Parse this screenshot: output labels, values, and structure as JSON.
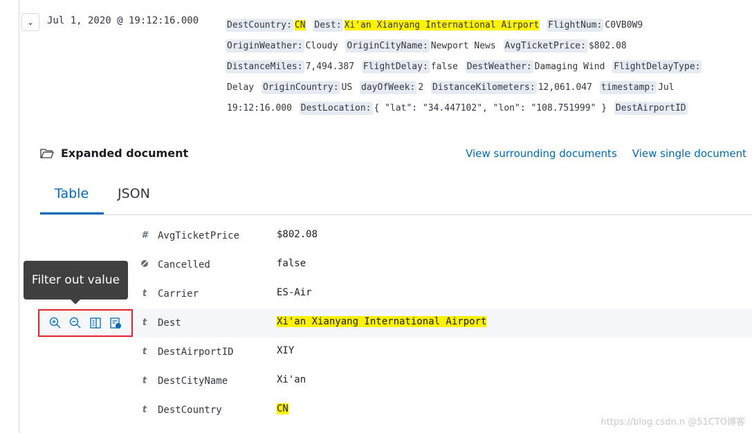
{
  "doc": {
    "timestamp": "Jul 1, 2020 @ 19:12:16.000",
    "summary_lines": [
      [
        {
          "k": "DestCountry:",
          "v": "CN",
          "hl": true
        },
        {
          "k": "Dest:",
          "v": "Xi'an Xianyang International Airport",
          "hl": true
        },
        {
          "k": "FlightNum:",
          "v": "C0VB0W9"
        }
      ],
      [
        {
          "k": "OriginWeather:",
          "v": "Cloudy"
        },
        {
          "k": "OriginCityName:",
          "v": "Newport News"
        },
        {
          "k": "AvgTicketPrice:",
          "v": "$802.08"
        }
      ],
      [
        {
          "k": "DistanceMiles:",
          "v": "7,494.387"
        },
        {
          "k": "FlightDelay:",
          "v": "false"
        },
        {
          "k": "DestWeather:",
          "v": "Damaging Wind"
        },
        {
          "k": "FlightDelayType:",
          "v": ""
        }
      ],
      [
        {
          "k": "",
          "v": "Delay"
        },
        {
          "k": "OriginCountry:",
          "v": "US"
        },
        {
          "k": "dayOfWeek:",
          "v": "2"
        },
        {
          "k": "DistanceKilometers:",
          "v": "12,061.047"
        },
        {
          "k": "timestamp:",
          "v": "Jul"
        }
      ],
      [
        {
          "k": "",
          "v": "19:12:16.000"
        },
        {
          "k": "DestLocation:",
          "v": "{ \"lat\": \"34.447102\", \"lon\": \"108.751999\" }"
        },
        {
          "k": "DestAirportID",
          "v": ""
        }
      ]
    ]
  },
  "expanded": {
    "title": "Expanded document",
    "view_surrounding": "View surrounding documents",
    "view_single": "View single document"
  },
  "tabs": [
    "Table",
    "JSON"
  ],
  "rows": [
    {
      "type": "#",
      "name": "AvgTicketPrice",
      "value": "$802.08"
    },
    {
      "type": "bool",
      "name": "Cancelled",
      "value": "false"
    },
    {
      "type": "t",
      "name": "Carrier",
      "value": "ES-Air"
    },
    {
      "type": "t",
      "name": "Dest",
      "value": "Xi'an Xianyang International Airport",
      "hl": true
    },
    {
      "type": "t",
      "name": "DestAirportID",
      "value": "XIY"
    },
    {
      "type": "t",
      "name": "DestCityName",
      "value": "Xi'an"
    },
    {
      "type": "t",
      "name": "DestCountry",
      "value": "CN",
      "hl": true
    }
  ],
  "tooltip": "Filter out value",
  "watermark": "https://blog.csdn.n @51CTO博客"
}
